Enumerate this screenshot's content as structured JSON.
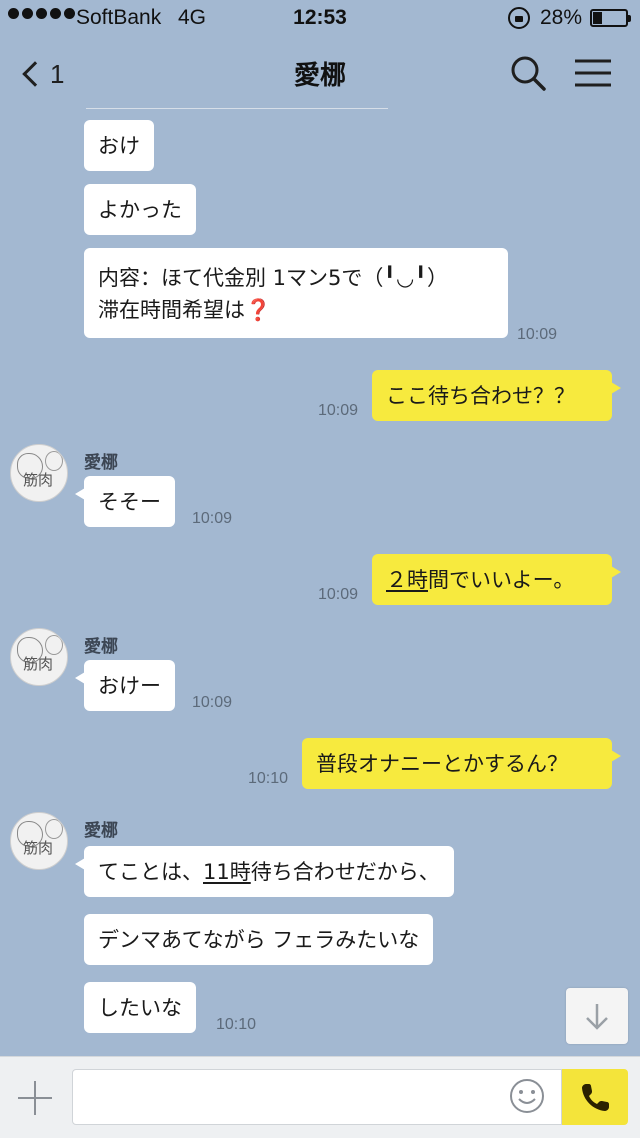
{
  "status_bar": {
    "carrier": "SoftBank",
    "network": "4G",
    "time": "12:53",
    "battery_percent": "28%"
  },
  "header": {
    "back_count": "1",
    "title": "愛梛"
  },
  "messages": [
    {
      "side": "left",
      "lines": [
        "おけ"
      ]
    },
    {
      "side": "left",
      "lines": [
        "よかった"
      ]
    },
    {
      "side": "left",
      "lines": [
        "内容：ほて代金別 1マン5で（╹◡╹）",
        "滞在時間希望は"
      ],
      "emoji": "❓",
      "time": "10:09"
    },
    {
      "side": "right",
      "lines": [
        "ここ待ち合わせ？？"
      ],
      "time": "10:09"
    },
    {
      "side": "left",
      "sender": "愛梛",
      "lines": [
        "そそー"
      ],
      "time": "10:09"
    },
    {
      "side": "right",
      "underlined": "２時",
      "rest": "間でいいよー。",
      "time": "10:09"
    },
    {
      "side": "left",
      "sender": "愛梛",
      "lines": [
        "おけー"
      ],
      "time": "10:09"
    },
    {
      "side": "right",
      "lines": [
        "普段オナニーとかするん？"
      ],
      "time": "10:10"
    },
    {
      "side": "left",
      "sender": "愛梛",
      "prefix": "てことは、",
      "underlined": "11時",
      "rest": "待ち合わせだから、"
    },
    {
      "side": "left",
      "lines": [
        "デンマあてながら フェラみたいな"
      ]
    },
    {
      "side": "left",
      "lines": [
        "したいな"
      ],
      "time": "10:10"
    }
  ],
  "avatar": {
    "label": "筋肉"
  },
  "input": {
    "placeholder": ""
  },
  "colors": {
    "background": "#a3b8d1",
    "my_bubble": "#f7ea3e",
    "their_bubble": "#ffffff",
    "call_button": "#f4e43a"
  },
  "icons": [
    "back-chevron-icon",
    "search-icon",
    "menu-icon",
    "scroll-down-arrow-icon",
    "plus-icon",
    "emoji-icon",
    "phone-icon",
    "lock-rotation-icon",
    "battery-icon"
  ]
}
